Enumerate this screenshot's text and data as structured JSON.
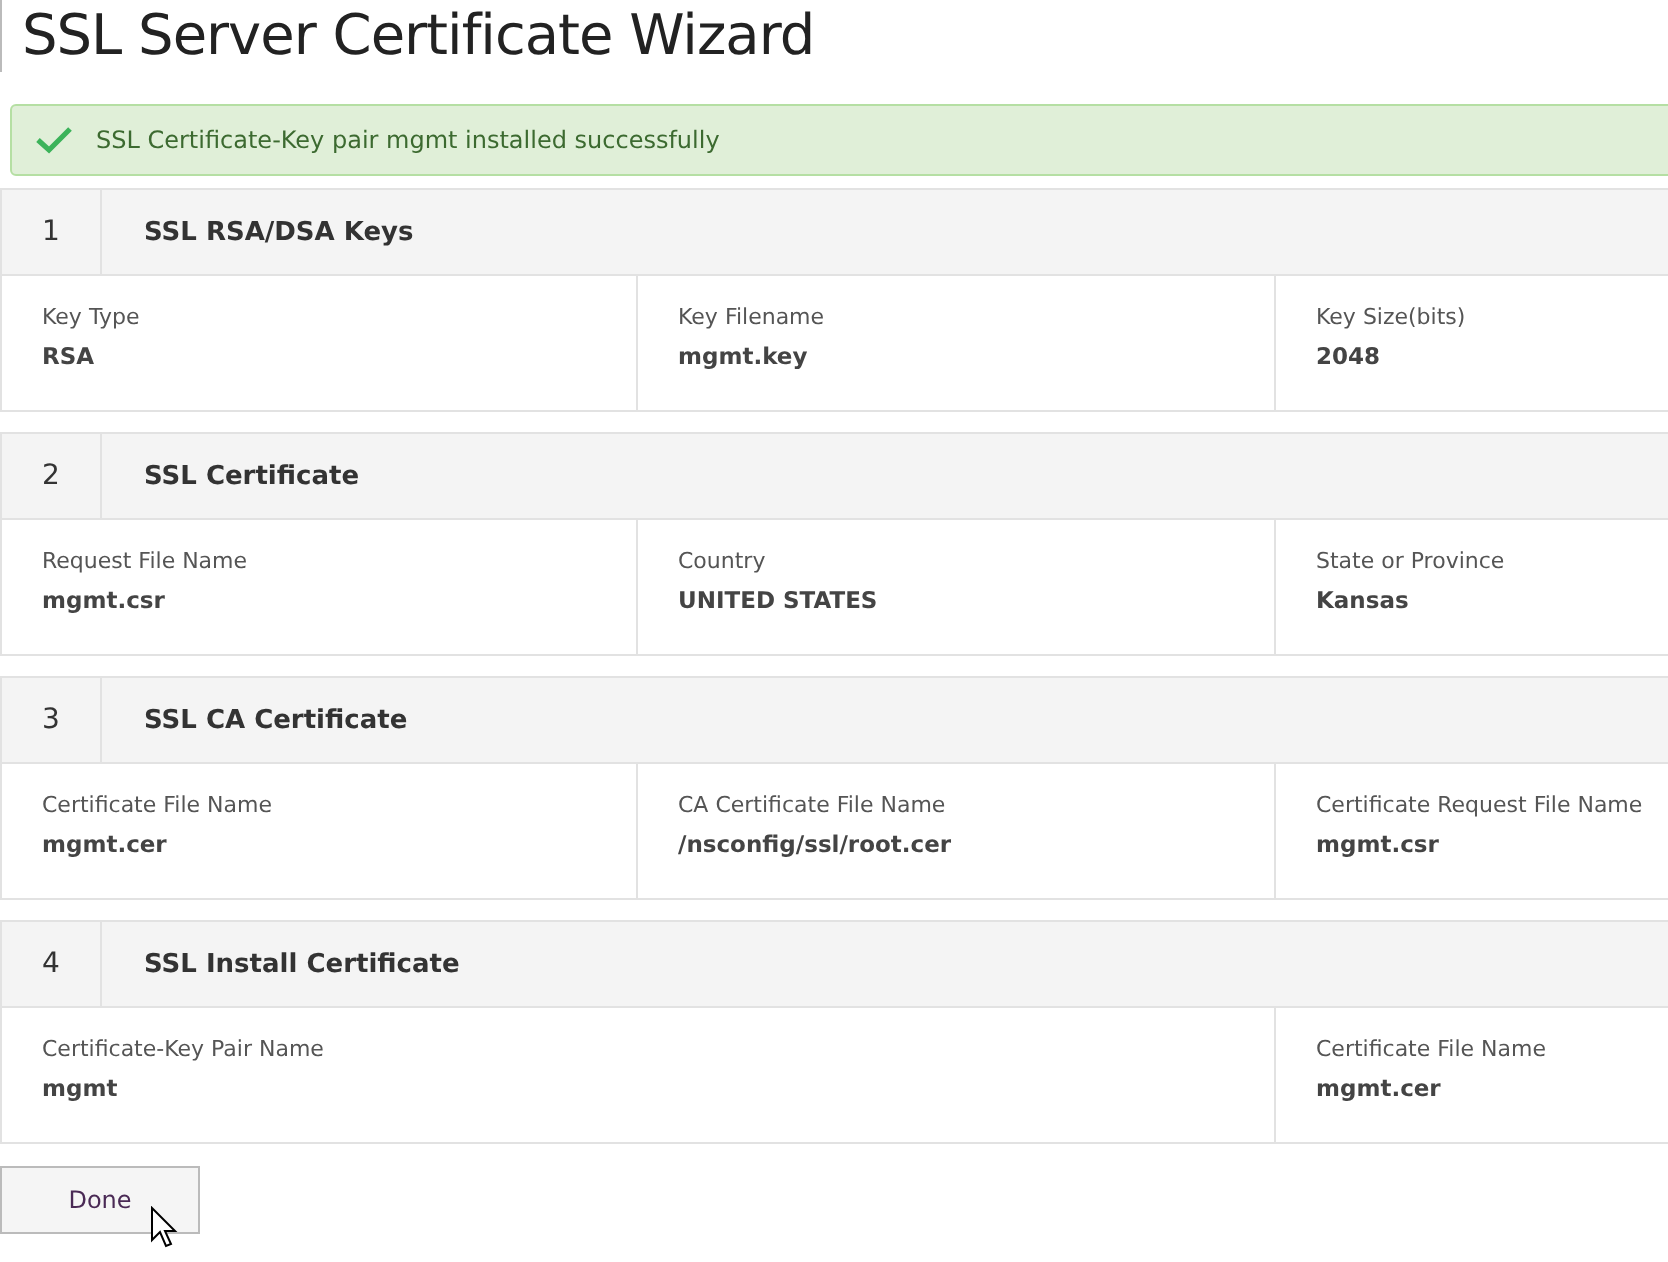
{
  "title": "SSL Server Certificate Wizard",
  "alert": {
    "kind": "success",
    "message": "SSL Certificate-Key pair mgmt installed successfully"
  },
  "sections": [
    {
      "number": "1",
      "title": "SSL RSA/DSA Keys",
      "fields": [
        {
          "label": "Key Type",
          "value": "RSA",
          "wide": false
        },
        {
          "label": "Key Filename",
          "value": "mgmt.key",
          "wide": false
        },
        {
          "label": "Key Size(bits)",
          "value": "2048",
          "wide": false
        }
      ]
    },
    {
      "number": "2",
      "title": "SSL Certificate",
      "fields": [
        {
          "label": "Request File Name",
          "value": "mgmt.csr",
          "wide": false
        },
        {
          "label": "Country",
          "value": "UNITED STATES",
          "wide": false
        },
        {
          "label": "State or Province",
          "value": "Kansas",
          "wide": false
        }
      ]
    },
    {
      "number": "3",
      "title": "SSL CA Certificate",
      "fields": [
        {
          "label": "Certificate File Name",
          "value": "mgmt.cer",
          "wide": false
        },
        {
          "label": "CA Certificate File Name",
          "value": "/nsconfig/ssl/root.cer",
          "wide": false
        },
        {
          "label": "Certificate Request File Name",
          "value": "mgmt.csr",
          "wide": false
        }
      ]
    },
    {
      "number": "4",
      "title": "SSL Install Certificate",
      "fields": [
        {
          "label": "Certificate-Key Pair Name",
          "value": "mgmt",
          "wide": true
        },
        {
          "label": "Certificate File Name",
          "value": "mgmt.cer",
          "wide": false
        }
      ]
    }
  ],
  "done_button": "Done"
}
